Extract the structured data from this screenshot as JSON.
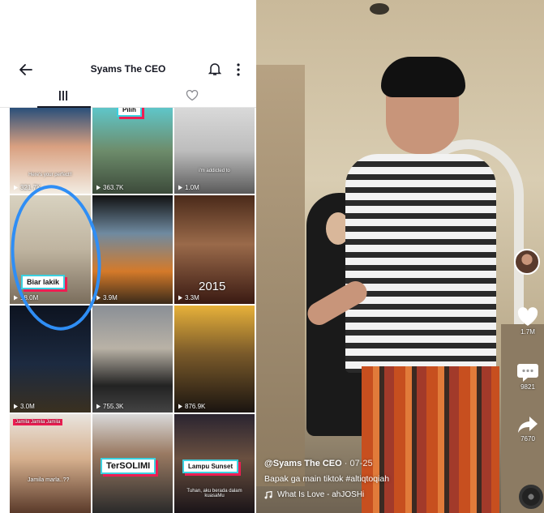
{
  "profile": {
    "title": "Syams The CEO",
    "tabs": [
      "videos-grid-icon",
      "liked-icon"
    ]
  },
  "grid": {
    "tiles": [
      {
        "views": "321.7K",
        "caption": "Here's your perfect!!",
        "tag": ""
      },
      {
        "views": "363.7K",
        "caption": "",
        "tag": "Pilih"
      },
      {
        "views": "1.0M",
        "caption": "i'm addicted to",
        "tag": ""
      },
      {
        "views": "18.0M",
        "caption": "",
        "tag": "Biar lakik"
      },
      {
        "views": "3.9M",
        "caption": "",
        "tag": ""
      },
      {
        "views": "3.3M",
        "caption": "2015",
        "tag": ""
      },
      {
        "views": "3.0M",
        "caption": "",
        "tag": ""
      },
      {
        "views": "755.3K",
        "caption": "",
        "tag": ""
      },
      {
        "views": "876.9K",
        "caption": "",
        "tag": ""
      },
      {
        "views": "",
        "caption": "Jamila Jamila Jamila",
        "tag": ""
      },
      {
        "views": "",
        "caption": "",
        "tag": "TerSOLIMI"
      },
      {
        "views": "",
        "caption": "Tuhan, aku berada dalam kuasaMu",
        "tag": "Lampu Sunset"
      }
    ],
    "small_caption": "Jamila marla..??"
  },
  "video": {
    "handle": "@Syams The CEO",
    "date": "· 07-25",
    "description": "Bapak ga main tiktok #altiqtoqiah",
    "music": "What Is Love - ahJOSHi",
    "likes": "1.7M",
    "comments": "9821",
    "shares": "7670"
  },
  "colors": {
    "highlight_circle": "#2f8ef5",
    "tag_border": "#3bd1e0",
    "tag_shadow": "#ee1d52"
  }
}
